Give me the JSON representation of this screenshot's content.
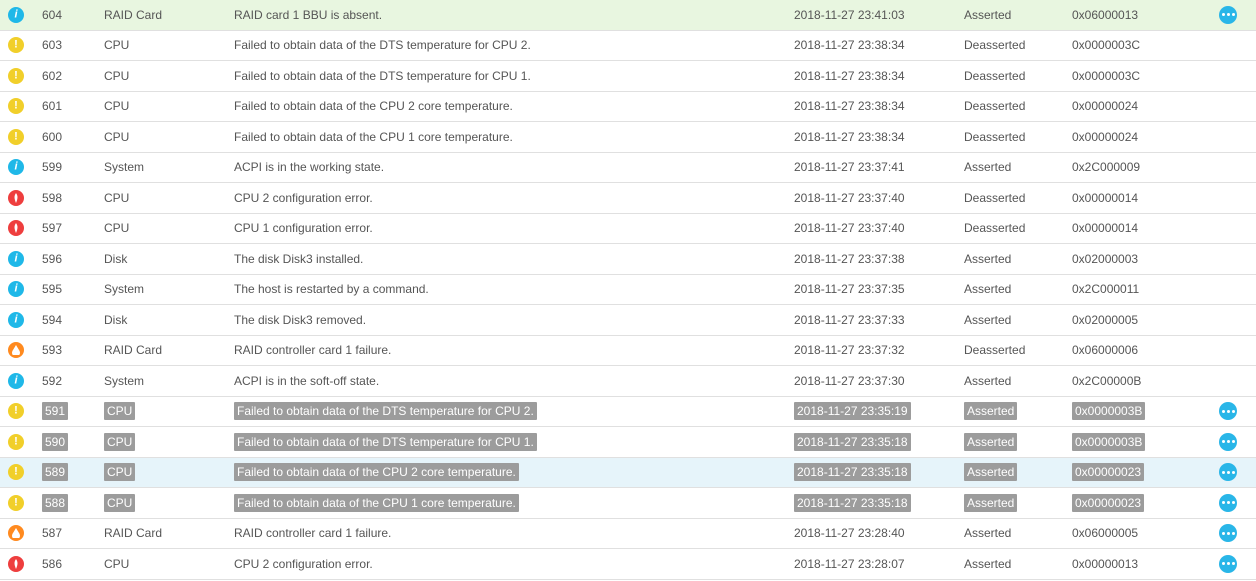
{
  "rows": [
    {
      "id": "604",
      "severity": "info",
      "component": "RAID Card",
      "description": "RAID card 1 BBU is absent.",
      "time": "2018-11-27 23:41:03",
      "state": "Asserted",
      "code": "0x06000013",
      "rowStyle": "green",
      "hl": false,
      "more": true
    },
    {
      "id": "603",
      "severity": "warning",
      "component": "CPU",
      "description": "Failed to obtain data of the DTS temperature for CPU 2.",
      "time": "2018-11-27 23:38:34",
      "state": "Deasserted",
      "code": "0x0000003C",
      "rowStyle": "",
      "hl": false,
      "more": false
    },
    {
      "id": "602",
      "severity": "warning",
      "component": "CPU",
      "description": "Failed to obtain data of the DTS temperature for CPU 1.",
      "time": "2018-11-27 23:38:34",
      "state": "Deasserted",
      "code": "0x0000003C",
      "rowStyle": "",
      "hl": false,
      "more": false
    },
    {
      "id": "601",
      "severity": "warning",
      "component": "CPU",
      "description": "Failed to obtain data of the CPU 2 core temperature.",
      "time": "2018-11-27 23:38:34",
      "state": "Deasserted",
      "code": "0x00000024",
      "rowStyle": "",
      "hl": false,
      "more": false
    },
    {
      "id": "600",
      "severity": "warning",
      "component": "CPU",
      "description": "Failed to obtain data of the CPU 1 core temperature.",
      "time": "2018-11-27 23:38:34",
      "state": "Deasserted",
      "code": "0x00000024",
      "rowStyle": "",
      "hl": false,
      "more": false
    },
    {
      "id": "599",
      "severity": "info",
      "component": "System",
      "description": "ACPI is in the working state.",
      "time": "2018-11-27 23:37:41",
      "state": "Asserted",
      "code": "0x2C000009",
      "rowStyle": "",
      "hl": false,
      "more": false
    },
    {
      "id": "598",
      "severity": "error",
      "component": "CPU",
      "description": "CPU 2 configuration error.",
      "time": "2018-11-27 23:37:40",
      "state": "Deasserted",
      "code": "0x00000014",
      "rowStyle": "",
      "hl": false,
      "more": false
    },
    {
      "id": "597",
      "severity": "error",
      "component": "CPU",
      "description": "CPU 1 configuration error.",
      "time": "2018-11-27 23:37:40",
      "state": "Deasserted",
      "code": "0x00000014",
      "rowStyle": "",
      "hl": false,
      "more": false
    },
    {
      "id": "596",
      "severity": "info",
      "component": "Disk",
      "description": "The disk Disk3 installed.",
      "time": "2018-11-27 23:37:38",
      "state": "Asserted",
      "code": "0x02000003",
      "rowStyle": "",
      "hl": false,
      "more": false
    },
    {
      "id": "595",
      "severity": "info",
      "component": "System",
      "description": "The host is restarted by a command.",
      "time": "2018-11-27 23:37:35",
      "state": "Asserted",
      "code": "0x2C000011",
      "rowStyle": "",
      "hl": false,
      "more": false
    },
    {
      "id": "594",
      "severity": "info",
      "component": "Disk",
      "description": "The disk Disk3 removed.",
      "time": "2018-11-27 23:37:33",
      "state": "Asserted",
      "code": "0x02000005",
      "rowStyle": "",
      "hl": false,
      "more": false
    },
    {
      "id": "593",
      "severity": "critical",
      "component": "RAID Card",
      "description": "RAID controller card 1 failure.",
      "time": "2018-11-27 23:37:32",
      "state": "Deasserted",
      "code": "0x06000006",
      "rowStyle": "",
      "hl": false,
      "more": false
    },
    {
      "id": "592",
      "severity": "info",
      "component": "System",
      "description": "ACPI is in the soft-off state.",
      "time": "2018-11-27 23:37:30",
      "state": "Asserted",
      "code": "0x2C00000B",
      "rowStyle": "",
      "hl": false,
      "more": false
    },
    {
      "id": "591",
      "severity": "warning",
      "component": "CPU",
      "description": "Failed to obtain data of the DTS temperature for CPU 2.",
      "time": "2018-11-27 23:35:19",
      "state": "Asserted",
      "code": "0x0000003B",
      "rowStyle": "",
      "hl": true,
      "more": true
    },
    {
      "id": "590",
      "severity": "warning",
      "component": "CPU",
      "description": "Failed to obtain data of the DTS temperature for CPU 1.",
      "time": "2018-11-27 23:35:18",
      "state": "Asserted",
      "code": "0x0000003B",
      "rowStyle": "",
      "hl": true,
      "more": true
    },
    {
      "id": "589",
      "severity": "warning",
      "component": "CPU",
      "description": "Failed to obtain data of the CPU 2 core temperature.",
      "time": "2018-11-27 23:35:18",
      "state": "Asserted",
      "code": "0x00000023",
      "rowStyle": "blue",
      "hl": true,
      "more": true
    },
    {
      "id": "588",
      "severity": "warning",
      "component": "CPU",
      "description": "Failed to obtain data of the CPU 1 core temperature.",
      "time": "2018-11-27 23:35:18",
      "state": "Asserted",
      "code": "0x00000023",
      "rowStyle": "",
      "hl": true,
      "more": true
    },
    {
      "id": "587",
      "severity": "critical",
      "component": "RAID Card",
      "description": "RAID controller card 1 failure.",
      "time": "2018-11-27 23:28:40",
      "state": "Asserted",
      "code": "0x06000005",
      "rowStyle": "",
      "hl": false,
      "more": true
    },
    {
      "id": "586",
      "severity": "error",
      "component": "CPU",
      "description": "CPU 2 configuration error.",
      "time": "2018-11-27 23:28:07",
      "state": "Asserted",
      "code": "0x00000013",
      "rowStyle": "",
      "hl": false,
      "more": true
    }
  ]
}
